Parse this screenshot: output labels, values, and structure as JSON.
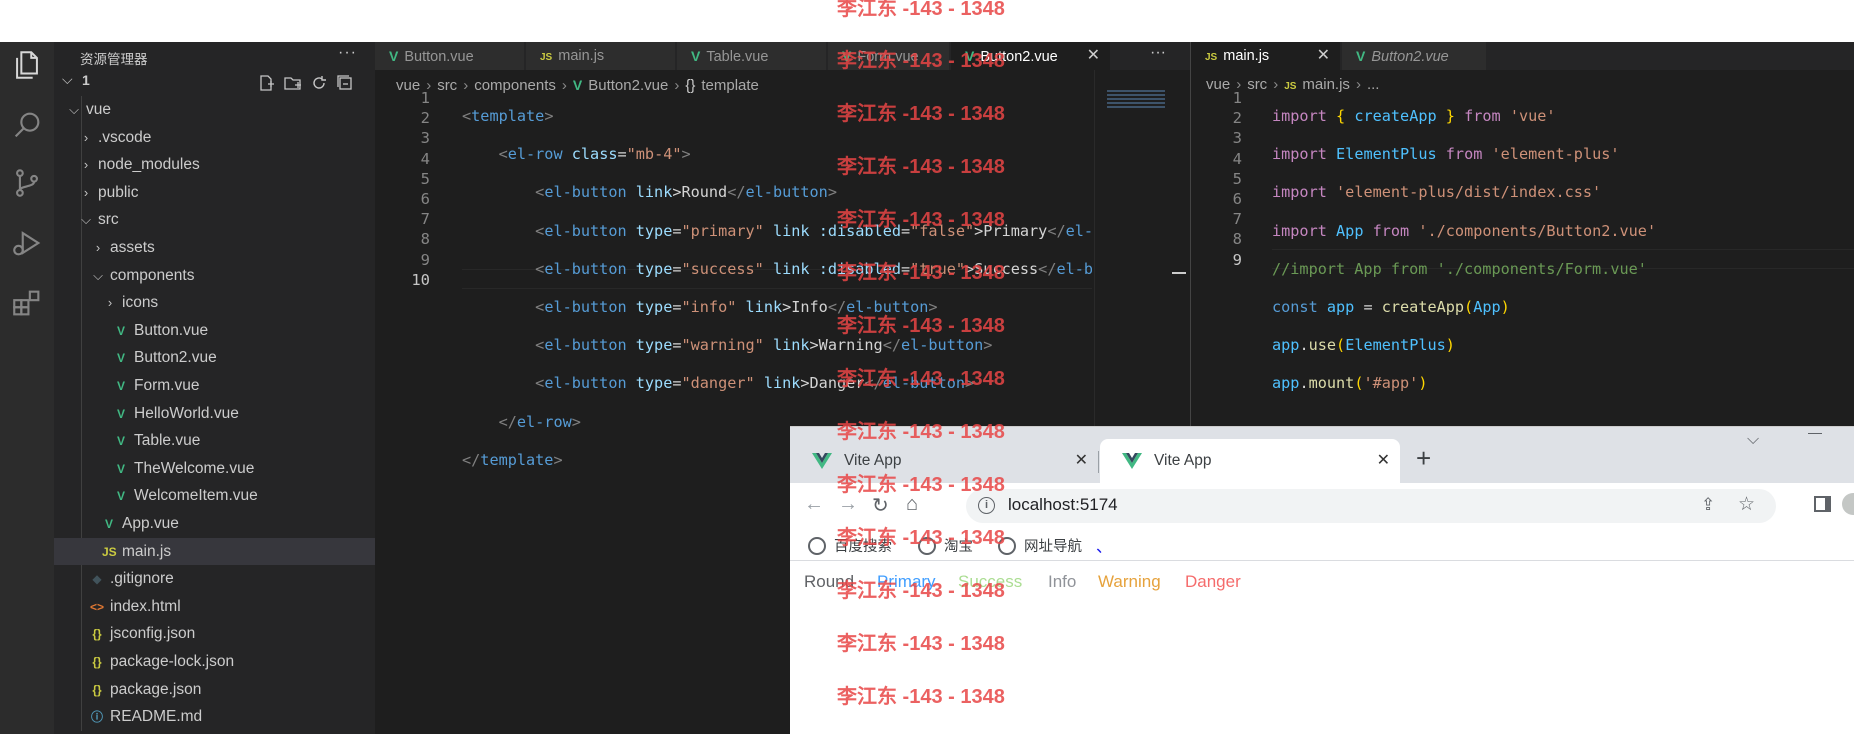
{
  "explorer": {
    "title": "资源管理器",
    "more": "···",
    "workspace": "1",
    "tree": [
      {
        "label": "vue",
        "kind": "folder-open",
        "depth": 0
      },
      {
        "label": ".vscode",
        "kind": "folder",
        "depth": 1
      },
      {
        "label": "node_modules",
        "kind": "folder",
        "depth": 1
      },
      {
        "label": "public",
        "kind": "folder",
        "depth": 1
      },
      {
        "label": "src",
        "kind": "folder-open",
        "depth": 1
      },
      {
        "label": "assets",
        "kind": "folder",
        "depth": 2
      },
      {
        "label": "components",
        "kind": "folder-open",
        "depth": 2
      },
      {
        "label": "icons",
        "kind": "folder",
        "depth": 3
      },
      {
        "label": "Button.vue",
        "kind": "vue",
        "depth": 3
      },
      {
        "label": "Button2.vue",
        "kind": "vue",
        "depth": 3
      },
      {
        "label": "Form.vue",
        "kind": "vue",
        "depth": 3
      },
      {
        "label": "HelloWorld.vue",
        "kind": "vue",
        "depth": 3
      },
      {
        "label": "Table.vue",
        "kind": "vue",
        "depth": 3
      },
      {
        "label": "TheWelcome.vue",
        "kind": "vue",
        "depth": 3
      },
      {
        "label": "WelcomeItem.vue",
        "kind": "vue",
        "depth": 3
      },
      {
        "label": "App.vue",
        "kind": "vue",
        "depth": 2
      },
      {
        "label": "main.js",
        "kind": "js",
        "depth": 2
      },
      {
        "label": ".gitignore",
        "kind": "git",
        "depth": 1
      },
      {
        "label": "index.html",
        "kind": "html",
        "depth": 1
      },
      {
        "label": "jsconfig.json",
        "kind": "json",
        "depth": 1
      },
      {
        "label": "package-lock.json",
        "kind": "json",
        "depth": 1
      },
      {
        "label": "package.json",
        "kind": "json",
        "depth": 1
      },
      {
        "label": "README.md",
        "kind": "info",
        "depth": 1
      }
    ]
  },
  "editor_left": {
    "tabs": [
      "Button.vue",
      "main.js",
      "Table.vue",
      "Form.vue",
      "Button2.vue"
    ],
    "more": "···",
    "breadcrumb": [
      "vue",
      "src",
      "components",
      "Button2.vue",
      "template"
    ],
    "line_numbers": [
      "1",
      "2",
      "3",
      "4",
      "5",
      "6",
      "7",
      "8",
      "9",
      "10"
    ]
  },
  "editor_right": {
    "tabs": [
      "main.js",
      "Button2.vue"
    ],
    "breadcrumb": [
      "vue",
      "src",
      "main.js",
      "..."
    ],
    "line_numbers": [
      "1",
      "2",
      "3",
      "4",
      "5",
      "6",
      "7",
      "8",
      "9"
    ]
  },
  "browser": {
    "tabs": [
      "Vite App",
      "Vite App"
    ],
    "new_tab": "+",
    "url": "localhost:5174",
    "bookmarks": [
      "百度搜索",
      "淘宝",
      "网址导航"
    ],
    "page_buttons": [
      {
        "label": "Round",
        "color": "#606266"
      },
      {
        "label": "Primary",
        "color": "#409eff"
      },
      {
        "label": "Success",
        "color": "#67c23a"
      },
      {
        "label": "Info",
        "color": "#909399"
      },
      {
        "label": "Warning",
        "color": "#e6a23c"
      },
      {
        "label": "Danger",
        "color": "#f56c6c"
      }
    ]
  },
  "watermark": "李江东 -143 - 1348"
}
